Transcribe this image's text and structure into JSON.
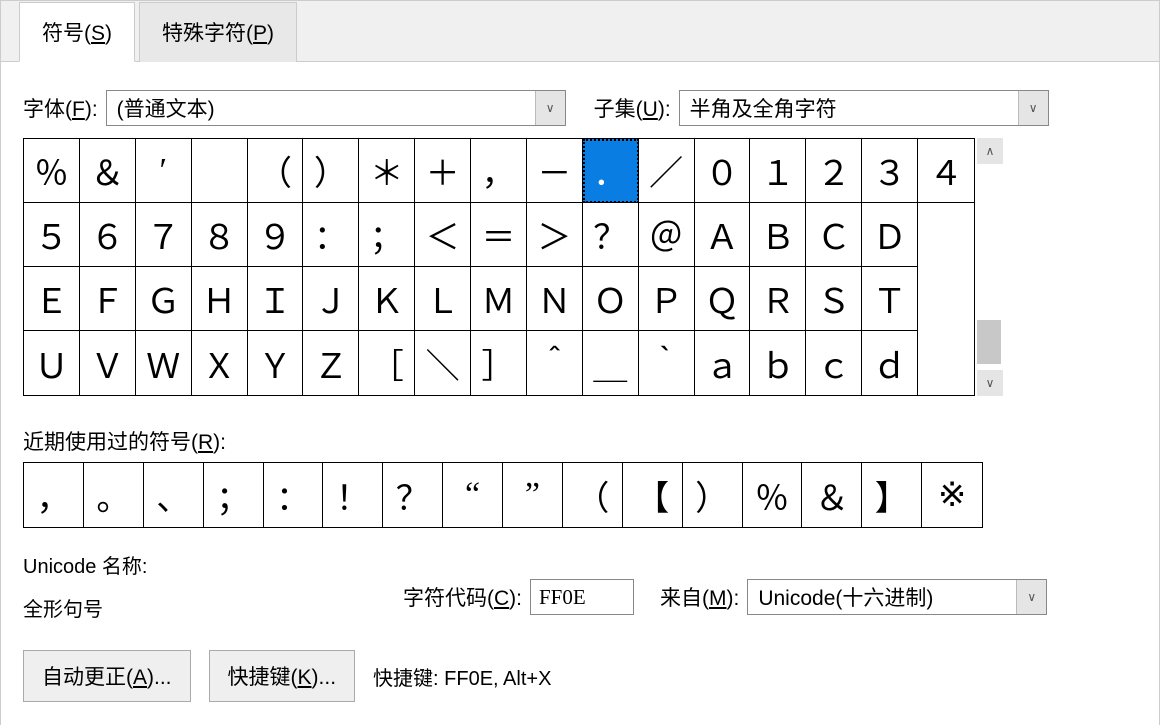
{
  "tabs": {
    "symbols": "符号(S)",
    "special": "特殊字符(P)"
  },
  "font": {
    "label": "字体(F):",
    "value": "(普通文本)"
  },
  "subset": {
    "label": "子集(U):",
    "value": "半角及全角字符"
  },
  "grid": {
    "row0": [
      "％",
      "＆",
      "′",
      "",
      "（",
      "）",
      "＊",
      "＋",
      "，",
      "－",
      "．",
      "／",
      "０",
      "１",
      "２",
      "３",
      "４"
    ],
    "row1": [
      "５",
      "６",
      "７",
      "８",
      "９",
      "：",
      "；",
      "＜",
      "＝",
      "＞",
      "？",
      "＠",
      "Ａ",
      "Ｂ",
      "Ｃ",
      "Ｄ",
      ""
    ],
    "row2": [
      "Ｅ",
      "Ｆ",
      "Ｇ",
      "Ｈ",
      "Ｉ",
      "Ｊ",
      "Ｋ",
      "Ｌ",
      "Ｍ",
      "Ｎ",
      "Ｏ",
      "Ｐ",
      "Ｑ",
      "Ｒ",
      "Ｓ",
      "Ｔ",
      ""
    ],
    "row3": [
      "Ｕ",
      "Ｖ",
      "Ｗ",
      "Ｘ",
      "Ｙ",
      "Ｚ",
      "［",
      "＼",
      "］",
      "＾",
      "＿",
      "｀",
      "ａ",
      "ｂ",
      "ｃ",
      "ｄ",
      ""
    ],
    "selected_index": 10
  },
  "recent": {
    "label": "近期使用过的符号(R):",
    "items": [
      "，",
      "。",
      "、",
      "；",
      "：",
      "！",
      "？",
      "“",
      "”",
      "（",
      "【",
      "）",
      "％",
      "＆",
      "】",
      "※"
    ]
  },
  "unicode_name": {
    "label": "Unicode 名称:",
    "value": "全形句号"
  },
  "code": {
    "label": "字符代码(C):",
    "value": "FF0E"
  },
  "from": {
    "label": "来自(M):",
    "value": "Unicode(十六进制)"
  },
  "buttons": {
    "autocorrect": "自动更正(A)...",
    "shortcut": "快捷键(K)..."
  },
  "shortcut_text": "快捷键: FF0E, Alt+X"
}
